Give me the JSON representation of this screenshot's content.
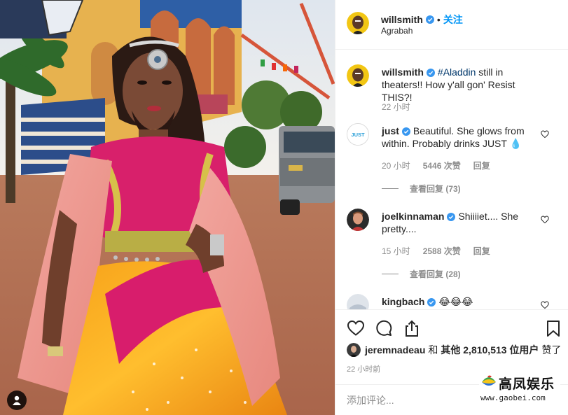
{
  "header": {
    "username": "willsmith",
    "follow_label": "关注",
    "location": "Agrabah"
  },
  "caption": {
    "username": "willsmith",
    "hashtag": "#Aladdin",
    "text": " still in theaters!! How y'all gon' Resist THIS?!",
    "time": "22 小时"
  },
  "comments": [
    {
      "username": "just",
      "text": "Beautiful. She glows from within. Probably drinks JUST 💧",
      "time": "20 小时",
      "likes": "5446 次赞",
      "reply": "回复",
      "view_replies": "查看回复 (73)",
      "avatar_text": "JUST"
    },
    {
      "username": "joelkinnaman",
      "text": "Shiiiiet.... She pretty....",
      "time": "15 小时",
      "likes": "2588 次赞",
      "reply": "回复",
      "view_replies": "查看回复 (28)"
    },
    {
      "username": "kingbach",
      "text": "😂😂😂"
    }
  ],
  "likes": {
    "liker": "jeremnadeau",
    "and": "和",
    "others": "其他 2,810,513 位用户",
    "suffix": "赞了"
  },
  "post_time": "22 小时前",
  "add_comment": {
    "placeholder": "添加评论..."
  },
  "watermark": {
    "title": "高凤娱乐",
    "url": "www.gaobei.com"
  },
  "colors": {
    "link_blue": "#0095f6",
    "verified_blue": "#3897f0",
    "secondary_text": "#8e8e8e",
    "border": "#efefef"
  },
  "icons": [
    "verified-badge-icon",
    "heart-icon",
    "comment-icon",
    "share-icon",
    "bookmark-icon",
    "user-tag-icon"
  ]
}
